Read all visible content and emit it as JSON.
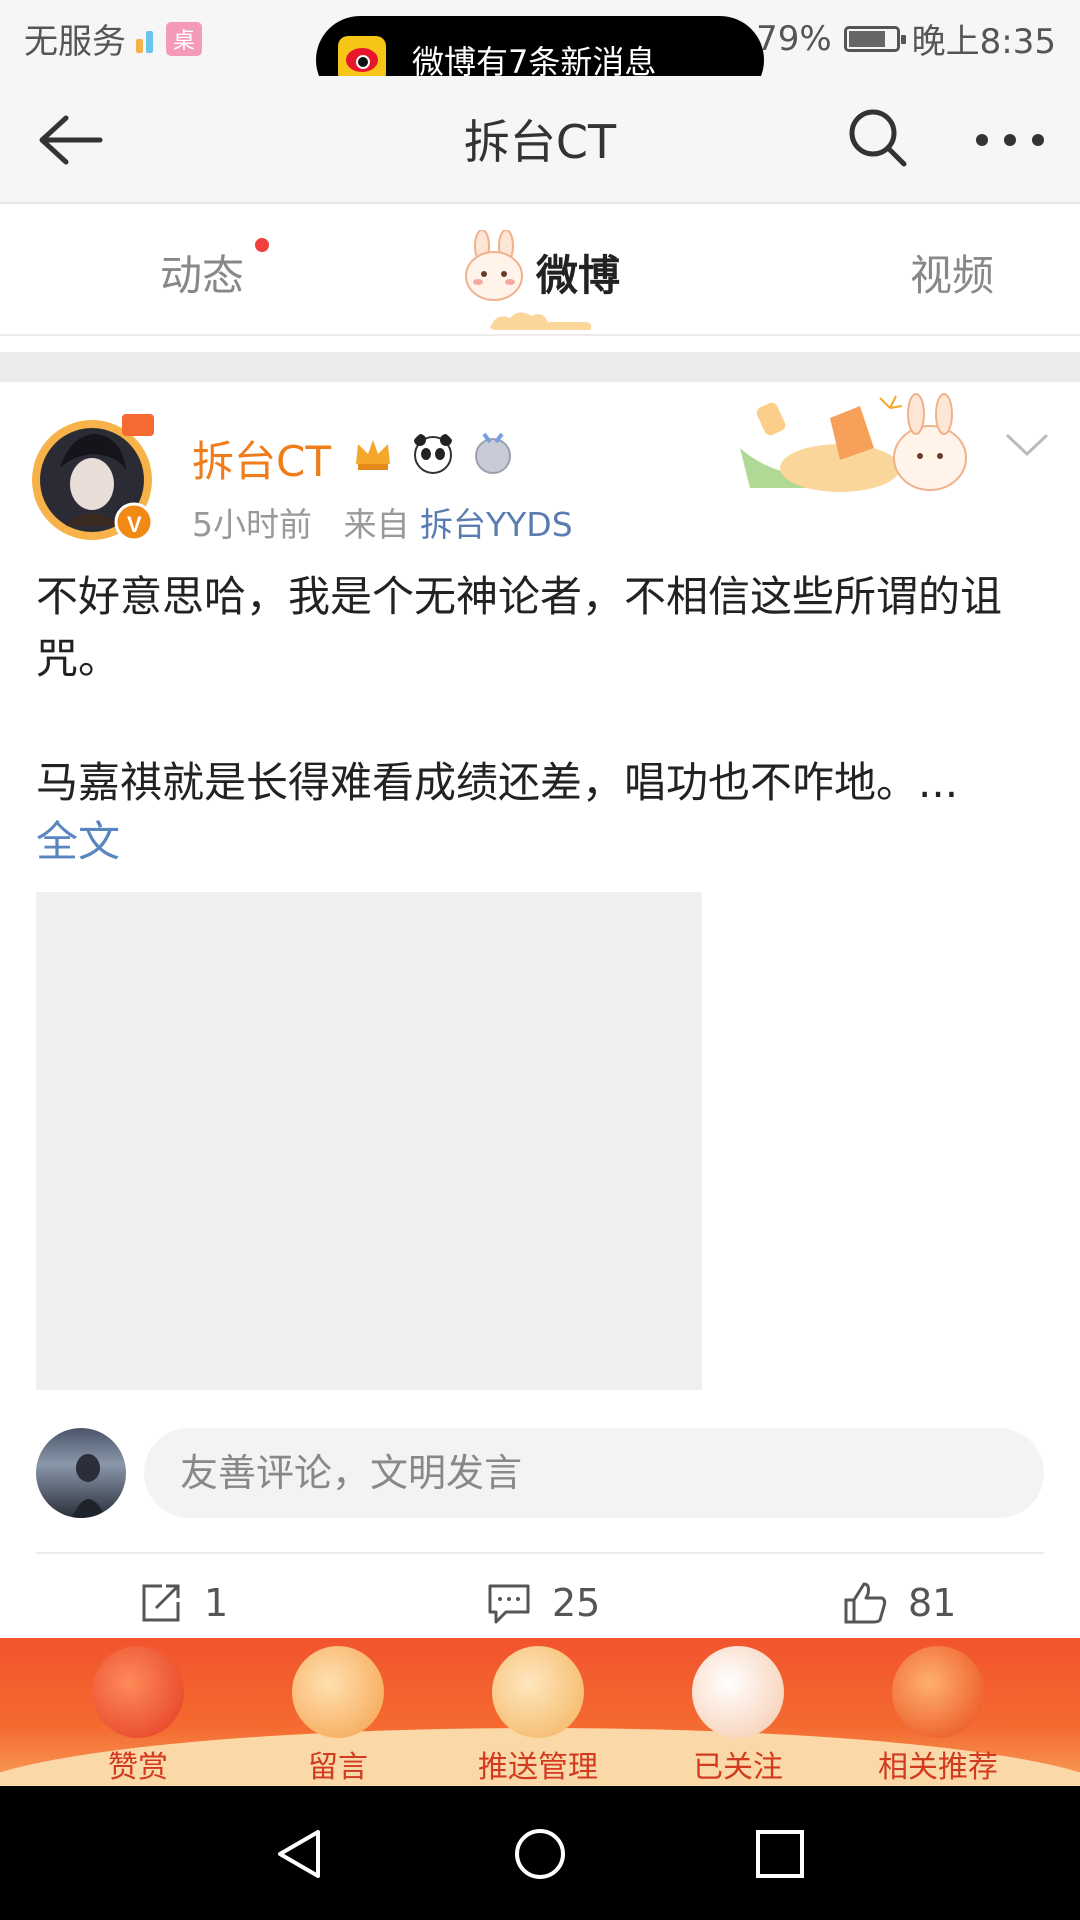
{
  "status_bar": {
    "carrier": "无服务",
    "desk_badge": "桌",
    "battery_percent": "79%",
    "battery_level": 0.79,
    "time": "晚上8:35"
  },
  "toast": {
    "text": "微博有7条新消息"
  },
  "header": {
    "title": "拆台CT"
  },
  "tabs": [
    {
      "label": "动态",
      "has_dot": true
    },
    {
      "label": "微博",
      "active": true
    },
    {
      "label": "视频"
    }
  ],
  "post": {
    "username": "拆台CT",
    "time": "5小时前",
    "source_prefix": "来自",
    "source": "拆台YYDS",
    "body_line1": "不好意思哈，我是个无神论者，不相信这些所谓的诅咒。",
    "body_line2": "马嘉祺就是长得难看成绩还差，唱功也不咋地。...",
    "full_text_link": "全文"
  },
  "comment_box": {
    "placeholder": "友善评论，文明发言"
  },
  "actions": {
    "repost_count": "1",
    "comment_count": "25",
    "like_count": "81"
  },
  "festive_bar": {
    "items": [
      {
        "label": "赞赏"
      },
      {
        "label": "留言"
      },
      {
        "label": "推送管理"
      },
      {
        "label": "已关注"
      },
      {
        "label": "相关推荐"
      }
    ]
  },
  "colors": {
    "username": "#f07c1a",
    "link": "#5a86bf",
    "festive_bg": "#f2542e",
    "tab_dot": "#f0403c"
  }
}
